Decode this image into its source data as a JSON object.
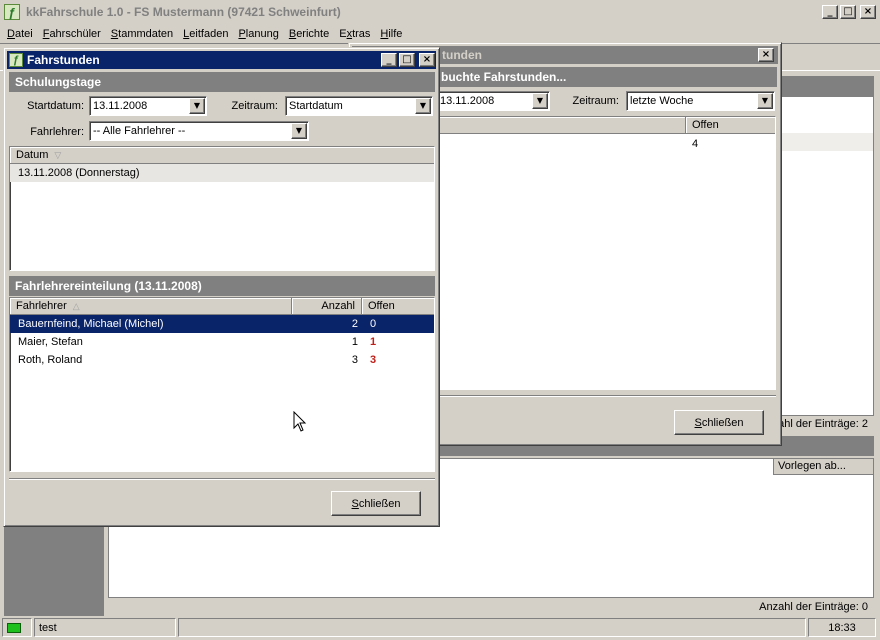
{
  "app": {
    "title": "kkFahrschule 1.0  -  FS Mustermann (97421 Schweinfurt)",
    "caption_min": "_",
    "caption_max": "□",
    "caption_close": "×"
  },
  "menu": [
    {
      "label": "Datei",
      "mn": "D",
      "rest": "atei"
    },
    {
      "label": "Fahrschüler",
      "mn": "F",
      "rest": "ahrschüler"
    },
    {
      "label": "Stammdaten",
      "mn": "S",
      "rest": "tammdaten"
    },
    {
      "label": "Leitfaden",
      "mn": "L",
      "rest": "eitfaden"
    },
    {
      "label": "Planung",
      "mn": "P",
      "rest": "lanung"
    },
    {
      "label": "Berichte",
      "mn": "B",
      "rest": "erichte"
    },
    {
      "label": "Extras",
      "mn": "E",
      "rest": "xtras",
      "pre": "E",
      "mid": "x",
      "post": "tras"
    },
    {
      "label": "Hilfe",
      "mn": "H",
      "rest": "ilfe"
    }
  ],
  "background": {
    "count1": "Anzahl der Einträge: 2",
    "list2_col": "Vorlegen ab...",
    "count2": "Anzahl der Einträge: 0"
  },
  "status": {
    "user": "test",
    "time": "18:33"
  },
  "win2": {
    "title_partial": "tunden",
    "header_partial": "buchte Fahrstunden...",
    "start_value": "13.11.2008",
    "zeitraum_label": "Zeitraum:",
    "zeitraum_value": "letzte Woche",
    "col_offen": "Offen",
    "row1_offen": "4",
    "close_label_mn": "S",
    "close_label_rest": "chließen"
  },
  "win1": {
    "title": "Fahrstunden",
    "section1": "Schulungstage",
    "start_label": "Startdatum:",
    "start_value": "13.11.2008",
    "zeitraum_label": "Zeitraum:",
    "zeitraum_value": "Startdatum",
    "fahrlehrer_label": "Fahrlehrer:",
    "fahrlehrer_value": "-- Alle Fahrlehrer --",
    "list1_col_datum": "Datum",
    "list1_rows": [
      "13.11.2008  (Donnerstag)"
    ],
    "section2": "Fahrlehrereinteilung (13.11.2008)",
    "list2_cols": {
      "fahrlehrer": "Fahrlehrer",
      "anzahl": "Anzahl",
      "offen": "Offen"
    },
    "list2_rows": [
      {
        "name": "Bauernfeind, Michael (Michel)",
        "anzahl": "2",
        "offen": "0"
      },
      {
        "name": "Maier, Stefan",
        "anzahl": "1",
        "offen": "1"
      },
      {
        "name": "Roth, Roland",
        "anzahl": "3",
        "offen": "3"
      }
    ],
    "close_label_mn": "S",
    "close_label_rest": "chließen"
  },
  "colors": {
    "active_title": "#0a246a",
    "inactive_title": "#808080",
    "highlight_red": "#c0201a",
    "status_led": "#1ec01e"
  },
  "icons": {
    "app": "app-logo-icon",
    "cursor": "mouse-pointer-icon",
    "sort_down": "sort-descending-icon",
    "sort_up": "sort-ascending-icon",
    "dropdown": "dropdown-arrow-icon"
  }
}
